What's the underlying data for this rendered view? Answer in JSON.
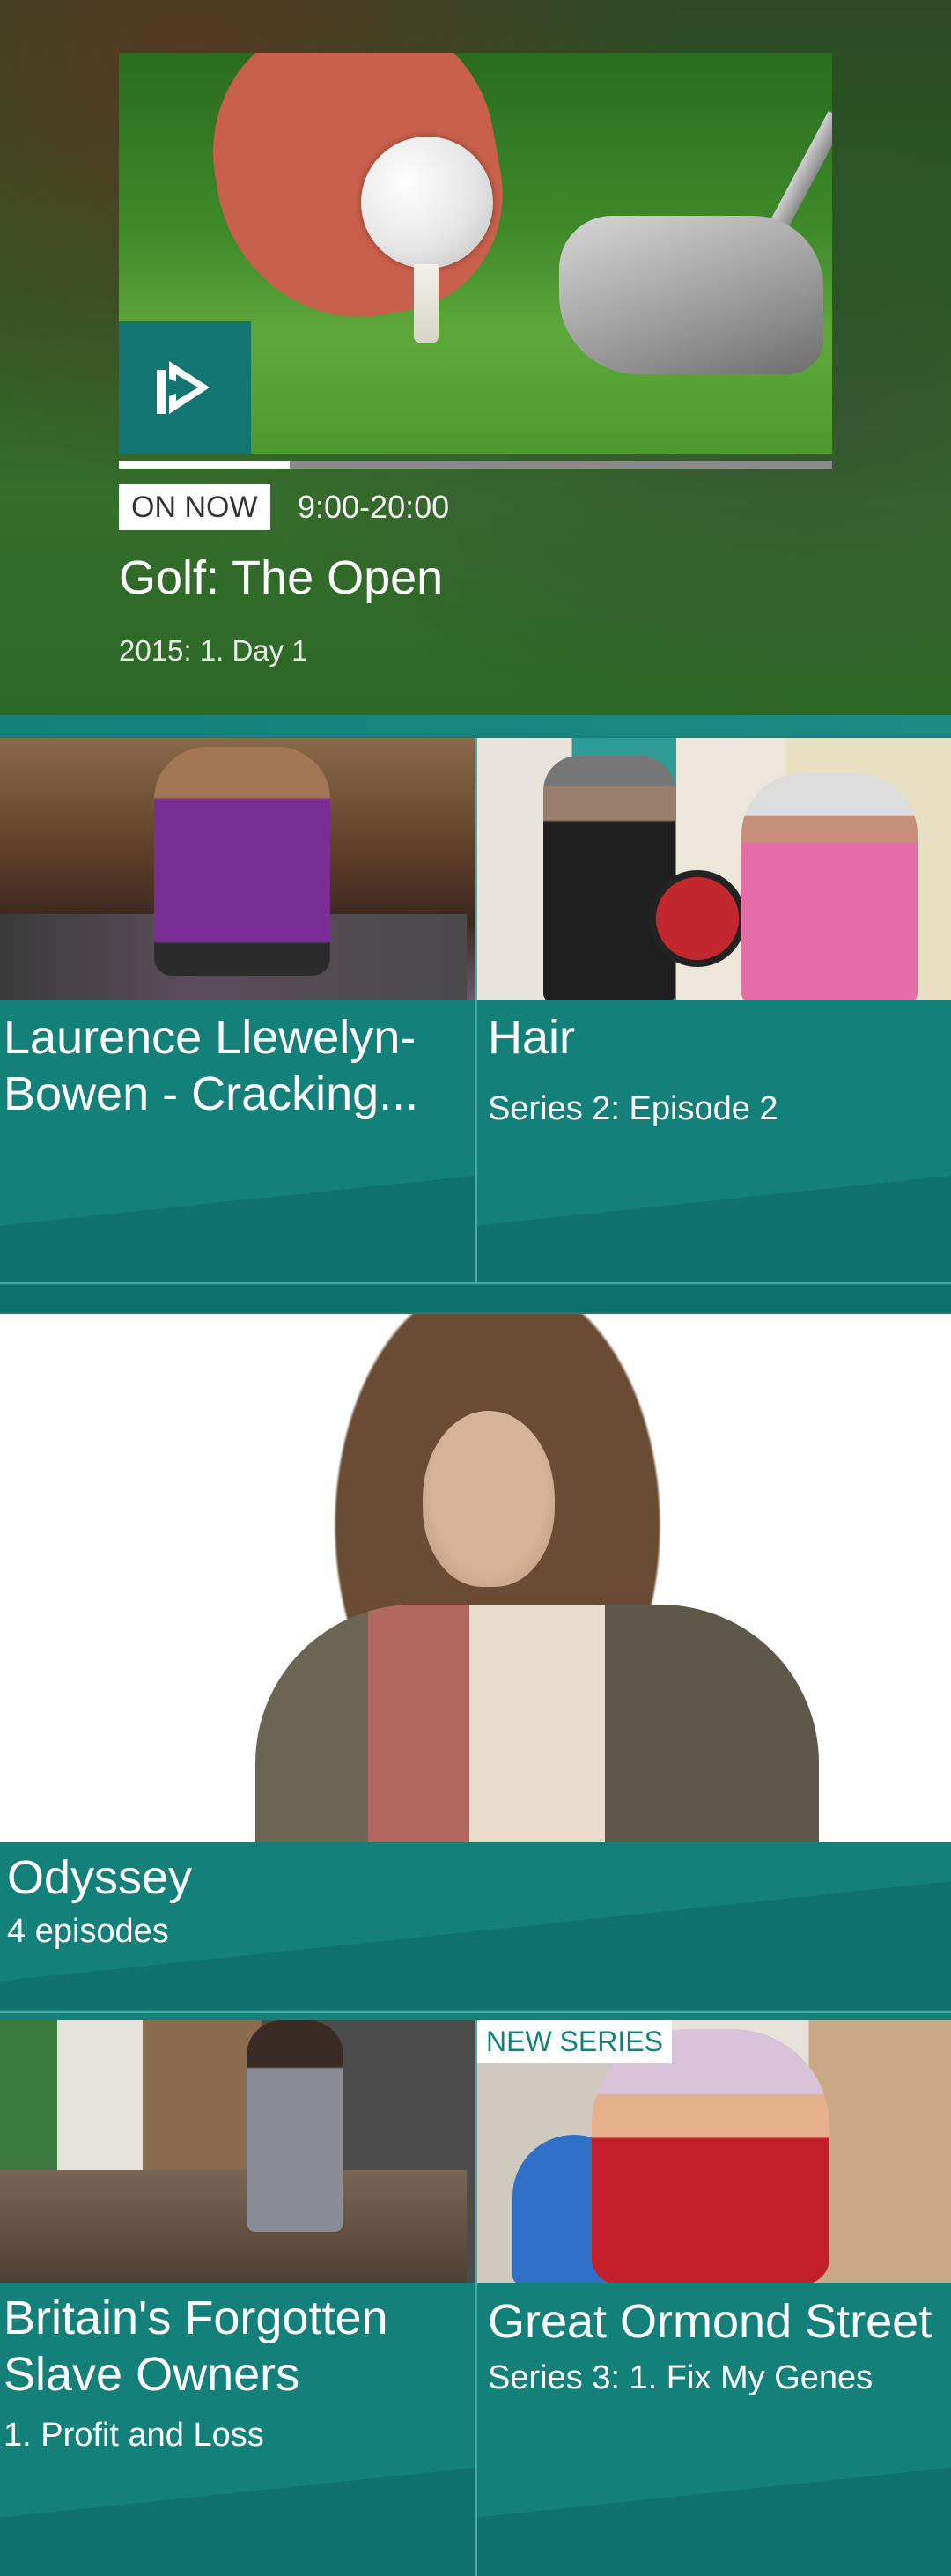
{
  "hero": {
    "on_now_label": "ON NOW",
    "time": "9:00-20:00",
    "title": "Golf: The Open",
    "subtitle": "2015: 1. Day 1",
    "progress": 0.24,
    "channel_icon": "play-logo-icon"
  },
  "cards": [
    {
      "title": "Laurence Llewelyn-Bowen - Cracking...",
      "subtitle": ""
    },
    {
      "title": "Hair",
      "subtitle": "Series 2: Episode 2"
    },
    {
      "title": "Odyssey",
      "subtitle": "4 episodes"
    },
    {
      "title": "Britain's Forgotten Slave Owners",
      "subtitle": "1. Profit and Loss"
    },
    {
      "title": "Great Ormond Street",
      "subtitle": "Series 3: 1. Fix My Genes",
      "badge": "NEW SERIES"
    }
  ],
  "colors": {
    "accent": "#13807a",
    "divider": "#4fa8a1"
  }
}
